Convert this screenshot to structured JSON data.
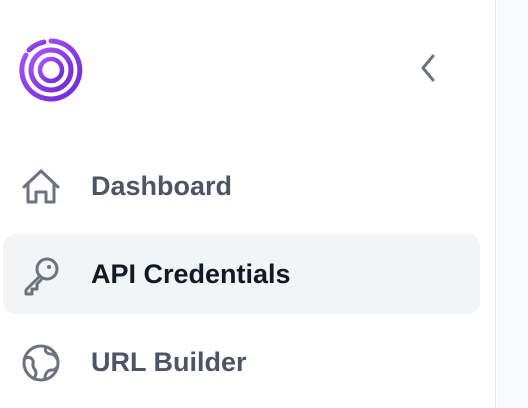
{
  "sidebar": {
    "collapse_icon": "chevron-left-icon",
    "logo_icon": "concentric-rings-logo",
    "items": [
      {
        "label": "Dashboard",
        "icon": "home-icon",
        "active": false
      },
      {
        "label": "API Credentials",
        "icon": "key-icon",
        "active": true
      },
      {
        "label": "URL Builder",
        "icon": "globe-icon",
        "active": false
      }
    ]
  },
  "colors": {
    "brand_start": "#9333ea",
    "brand_end": "#6d28d9",
    "active_bg": "#f3f4f6",
    "text_muted": "#4b5563",
    "text_active": "#111827",
    "icon": "#6b7280"
  }
}
